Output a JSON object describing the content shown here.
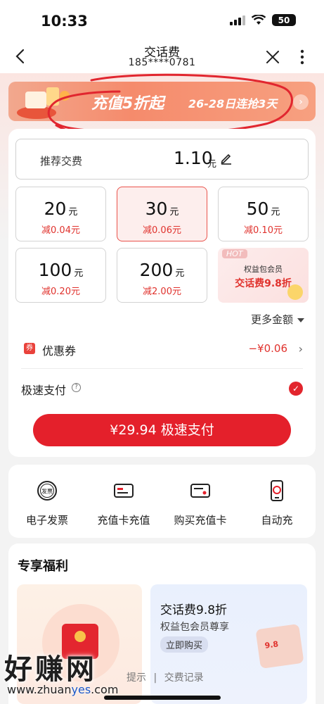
{
  "status": {
    "time": "10:33",
    "battery": "50"
  },
  "nav": {
    "title": "交话费",
    "phone": "185****0781"
  },
  "banner": {
    "text": "充值5折起",
    "date": "26-28日连抢3天"
  },
  "recommend": {
    "label": "推荐交费",
    "amount": "1.10",
    "unit": "元"
  },
  "amounts": [
    {
      "value": "20",
      "unit": "元",
      "discount": "减0.04元"
    },
    {
      "value": "30",
      "unit": "元",
      "discount": "减0.06元"
    },
    {
      "value": "50",
      "unit": "元",
      "discount": "减0.10元"
    },
    {
      "value": "100",
      "unit": "元",
      "discount": "减0.20元"
    },
    {
      "value": "200",
      "unit": "元",
      "discount": "减2.00元"
    }
  ],
  "selected_amount_index": 1,
  "promo": {
    "tag": "HOT",
    "line1": "权益包会员",
    "line2": "交话费9.8折"
  },
  "more": "更多金额",
  "coupon": {
    "icon_text": "券",
    "label": "优惠券",
    "value": "−¥0.06"
  },
  "fast_pay": {
    "label": "极速支付",
    "checked": true
  },
  "pay_button": "¥29.94 极速支付",
  "tools": [
    {
      "label": "电子发票",
      "icon": "invoice-icon",
      "icon_text": "发票"
    },
    {
      "label": "充值卡充值",
      "icon": "recharge-card-icon"
    },
    {
      "label": "购买充值卡",
      "icon": "buy-card-icon"
    },
    {
      "label": "自动充",
      "icon": "auto-recharge-icon"
    }
  ],
  "benefits": {
    "title": "专享福利",
    "right": {
      "title": "交话费9.8折",
      "subtitle": "权益包会员尊享",
      "button": "立即购买",
      "art_text": "9.8"
    }
  },
  "footer": {
    "link1": "提示",
    "sep": "|",
    "link2": "交费记录"
  },
  "watermark": {
    "text": "好赚网",
    "url_prefix": "www.zhuan",
    "url_highlight": "yes",
    "url_suffix": ".com"
  },
  "colors": {
    "brand_red": "#e4202b",
    "discount_red": "#e0322d"
  }
}
